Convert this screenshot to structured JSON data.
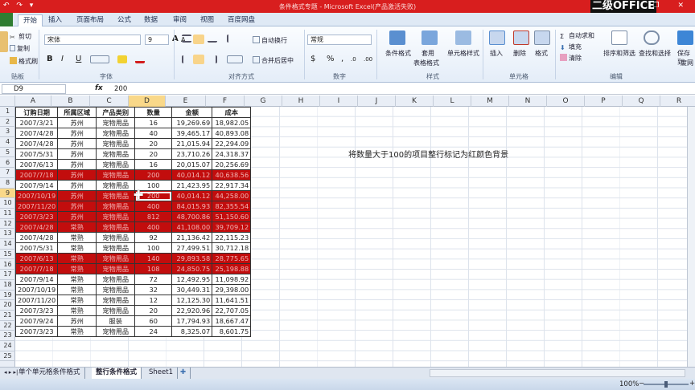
{
  "window": {
    "title": "条件格式专题 - Microsoft Excel(产品激活失败)",
    "brand": "二级OFFICE",
    "quick_access": "↶ ↷ ▾",
    "window_controls": "─ ❐ ✕"
  },
  "ribbon_tabs": [
    "开始",
    "插入",
    "页面布局",
    "公式",
    "数据",
    "审阅",
    "视图",
    "百度网盘"
  ],
  "ribbon": {
    "clipboard": {
      "cut": "剪切",
      "copy": "复制",
      "painter": "格式刷",
      "label": "贴板"
    },
    "font": {
      "name": "宋体",
      "size": "9",
      "label": "字体",
      "bold": "B",
      "italic": "I",
      "underline": "U",
      "grow": "A",
      "shrink": "A",
      "fill_color": "#f2d233",
      "font_color": "#d21e1e"
    },
    "alignment": {
      "wrap": "自动换行",
      "merge": "合并后居中",
      "label": "对齐方式"
    },
    "number": {
      "format": "常规",
      "label": "数字",
      "currency": "$",
      "percent": "%",
      "comma": ",",
      "inc_dec": ".0",
      "dec_dec": ".00"
    },
    "styles": {
      "cond": "条件格式",
      "table": "套用",
      "table2": "表格格式",
      "cell": "单元格样式",
      "label": "样式"
    },
    "cells": {
      "insert": "插入",
      "delete": "删除",
      "format": "格式",
      "label": "单元格"
    },
    "editing": {
      "autosum": "自动求和",
      "fill": "填充",
      "clear": "清除",
      "sort": "排序和筛选",
      "find": "查找和选择",
      "save": "保存到",
      "save2": "度网",
      "label": "编辑"
    }
  },
  "formula_bar": {
    "cell_ref": "D9",
    "fx": "fx",
    "value": "200"
  },
  "columns": [
    "A",
    "B",
    "C",
    "D",
    "E",
    "F",
    "G",
    "H",
    "I",
    "J",
    "K",
    "L",
    "M",
    "N",
    "O",
    "P",
    "Q",
    "R"
  ],
  "selected_column": "D",
  "rows": [
    "1",
    "2",
    "3",
    "4",
    "5",
    "6",
    "7",
    "8",
    "9",
    "10",
    "11",
    "12",
    "13",
    "14",
    "15",
    "16",
    "17",
    "18",
    "19",
    "20",
    "21",
    "22",
    "23",
    "24",
    "25"
  ],
  "selected_row": "9",
  "table": {
    "headers": [
      "订购日期",
      "所属区域",
      "产品类别",
      "数量",
      "金额",
      "成本"
    ],
    "rows": [
      {
        "date": "2007/3/21",
        "region": "苏州",
        "cat": "宠物用品",
        "qty": "16",
        "amt": "19,269.69",
        "cost": "18,982.05",
        "hl": false
      },
      {
        "date": "2007/4/28",
        "region": "苏州",
        "cat": "宠物用品",
        "qty": "40",
        "amt": "39,465.17",
        "cost": "40,893.08",
        "hl": false
      },
      {
        "date": "2007/4/28",
        "region": "苏州",
        "cat": "宠物用品",
        "qty": "20",
        "amt": "21,015.94",
        "cost": "22,294.09",
        "hl": false
      },
      {
        "date": "2007/5/31",
        "region": "苏州",
        "cat": "宠物用品",
        "qty": "20",
        "amt": "23,710.26",
        "cost": "24,318.37",
        "hl": false
      },
      {
        "date": "2007/6/13",
        "region": "苏州",
        "cat": "宠物用品",
        "qty": "16",
        "amt": "20,015.07",
        "cost": "20,256.69",
        "hl": false
      },
      {
        "date": "2007/7/18",
        "region": "苏州",
        "cat": "宠物用品",
        "qty": "200",
        "amt": "40,014.12",
        "cost": "40,638.56",
        "hl": true
      },
      {
        "date": "2007/9/14",
        "region": "苏州",
        "cat": "宠物用品",
        "qty": "100",
        "amt": "21,423.95",
        "cost": "22,917.34",
        "hl": false
      },
      {
        "date": "2007/10/19",
        "region": "苏州",
        "cat": "宠物用品",
        "qty": "200",
        "amt": "40,014.12",
        "cost": "44,258.00",
        "hl": true,
        "sel": true
      },
      {
        "date": "2007/11/20",
        "region": "苏州",
        "cat": "宠物用品",
        "qty": "400",
        "amt": "84,015.93",
        "cost": "82,355.54",
        "hl": true
      },
      {
        "date": "2007/3/23",
        "region": "苏州",
        "cat": "宠物用品",
        "qty": "812",
        "amt": "48,700.86",
        "cost": "51,150.60",
        "hl": true
      },
      {
        "date": "2007/4/28",
        "region": "常熟",
        "cat": "宠物用品",
        "qty": "400",
        "amt": "41,108.00",
        "cost": "39,709.12",
        "hl": true
      },
      {
        "date": "2007/4/28",
        "region": "常熟",
        "cat": "宠物用品",
        "qty": "92",
        "amt": "21,136.42",
        "cost": "22,115.23",
        "hl": false
      },
      {
        "date": "2007/5/31",
        "region": "常熟",
        "cat": "宠物用品",
        "qty": "100",
        "amt": "27,499.51",
        "cost": "30,712.18",
        "hl": false
      },
      {
        "date": "2007/6/13",
        "region": "常熟",
        "cat": "宠物用品",
        "qty": "140",
        "amt": "29,893.58",
        "cost": "28,775.65",
        "hl": true
      },
      {
        "date": "2007/7/18",
        "region": "常熟",
        "cat": "宠物用品",
        "qty": "108",
        "amt": "24,850.75",
        "cost": "25,198.88",
        "hl": true
      },
      {
        "date": "2007/9/14",
        "region": "常熟",
        "cat": "宠物用品",
        "qty": "72",
        "amt": "12,492.95",
        "cost": "11,098.92",
        "hl": false
      },
      {
        "date": "2007/10/19",
        "region": "常熟",
        "cat": "宠物用品",
        "qty": "32",
        "amt": "30,449.31",
        "cost": "29,398.00",
        "hl": false
      },
      {
        "date": "2007/11/20",
        "region": "常熟",
        "cat": "宠物用品",
        "qty": "12",
        "amt": "12,125.30",
        "cost": "11,641.51",
        "hl": false
      },
      {
        "date": "2007/3/23",
        "region": "常熟",
        "cat": "宠物用品",
        "qty": "20",
        "amt": "22,920.96",
        "cost": "22,707.05",
        "hl": false
      },
      {
        "date": "2007/9/24",
        "region": "苏州",
        "cat": "服装",
        "qty": "60",
        "amt": "17,794.93",
        "cost": "18,667.47",
        "hl": false
      },
      {
        "date": "2007/3/23",
        "region": "常熟",
        "cat": "宠物用品",
        "qty": "24",
        "amt": "8,325.07",
        "cost": "8,601.75",
        "hl": false
      }
    ]
  },
  "highlight_color": "#c20d0d",
  "note": "将数量大于100的项目整行标记为红颜色背景",
  "sheet_nav": "◂ ▸ ▸|",
  "sheets": [
    "单个单元格条件格式",
    "整行条件格式",
    "Sheet1"
  ],
  "active_sheet": "整行条件格式",
  "new_sheet_icon": "✚",
  "status": {
    "zoom": "100%",
    "zoom_out": "−",
    "zoom_in": "+"
  }
}
